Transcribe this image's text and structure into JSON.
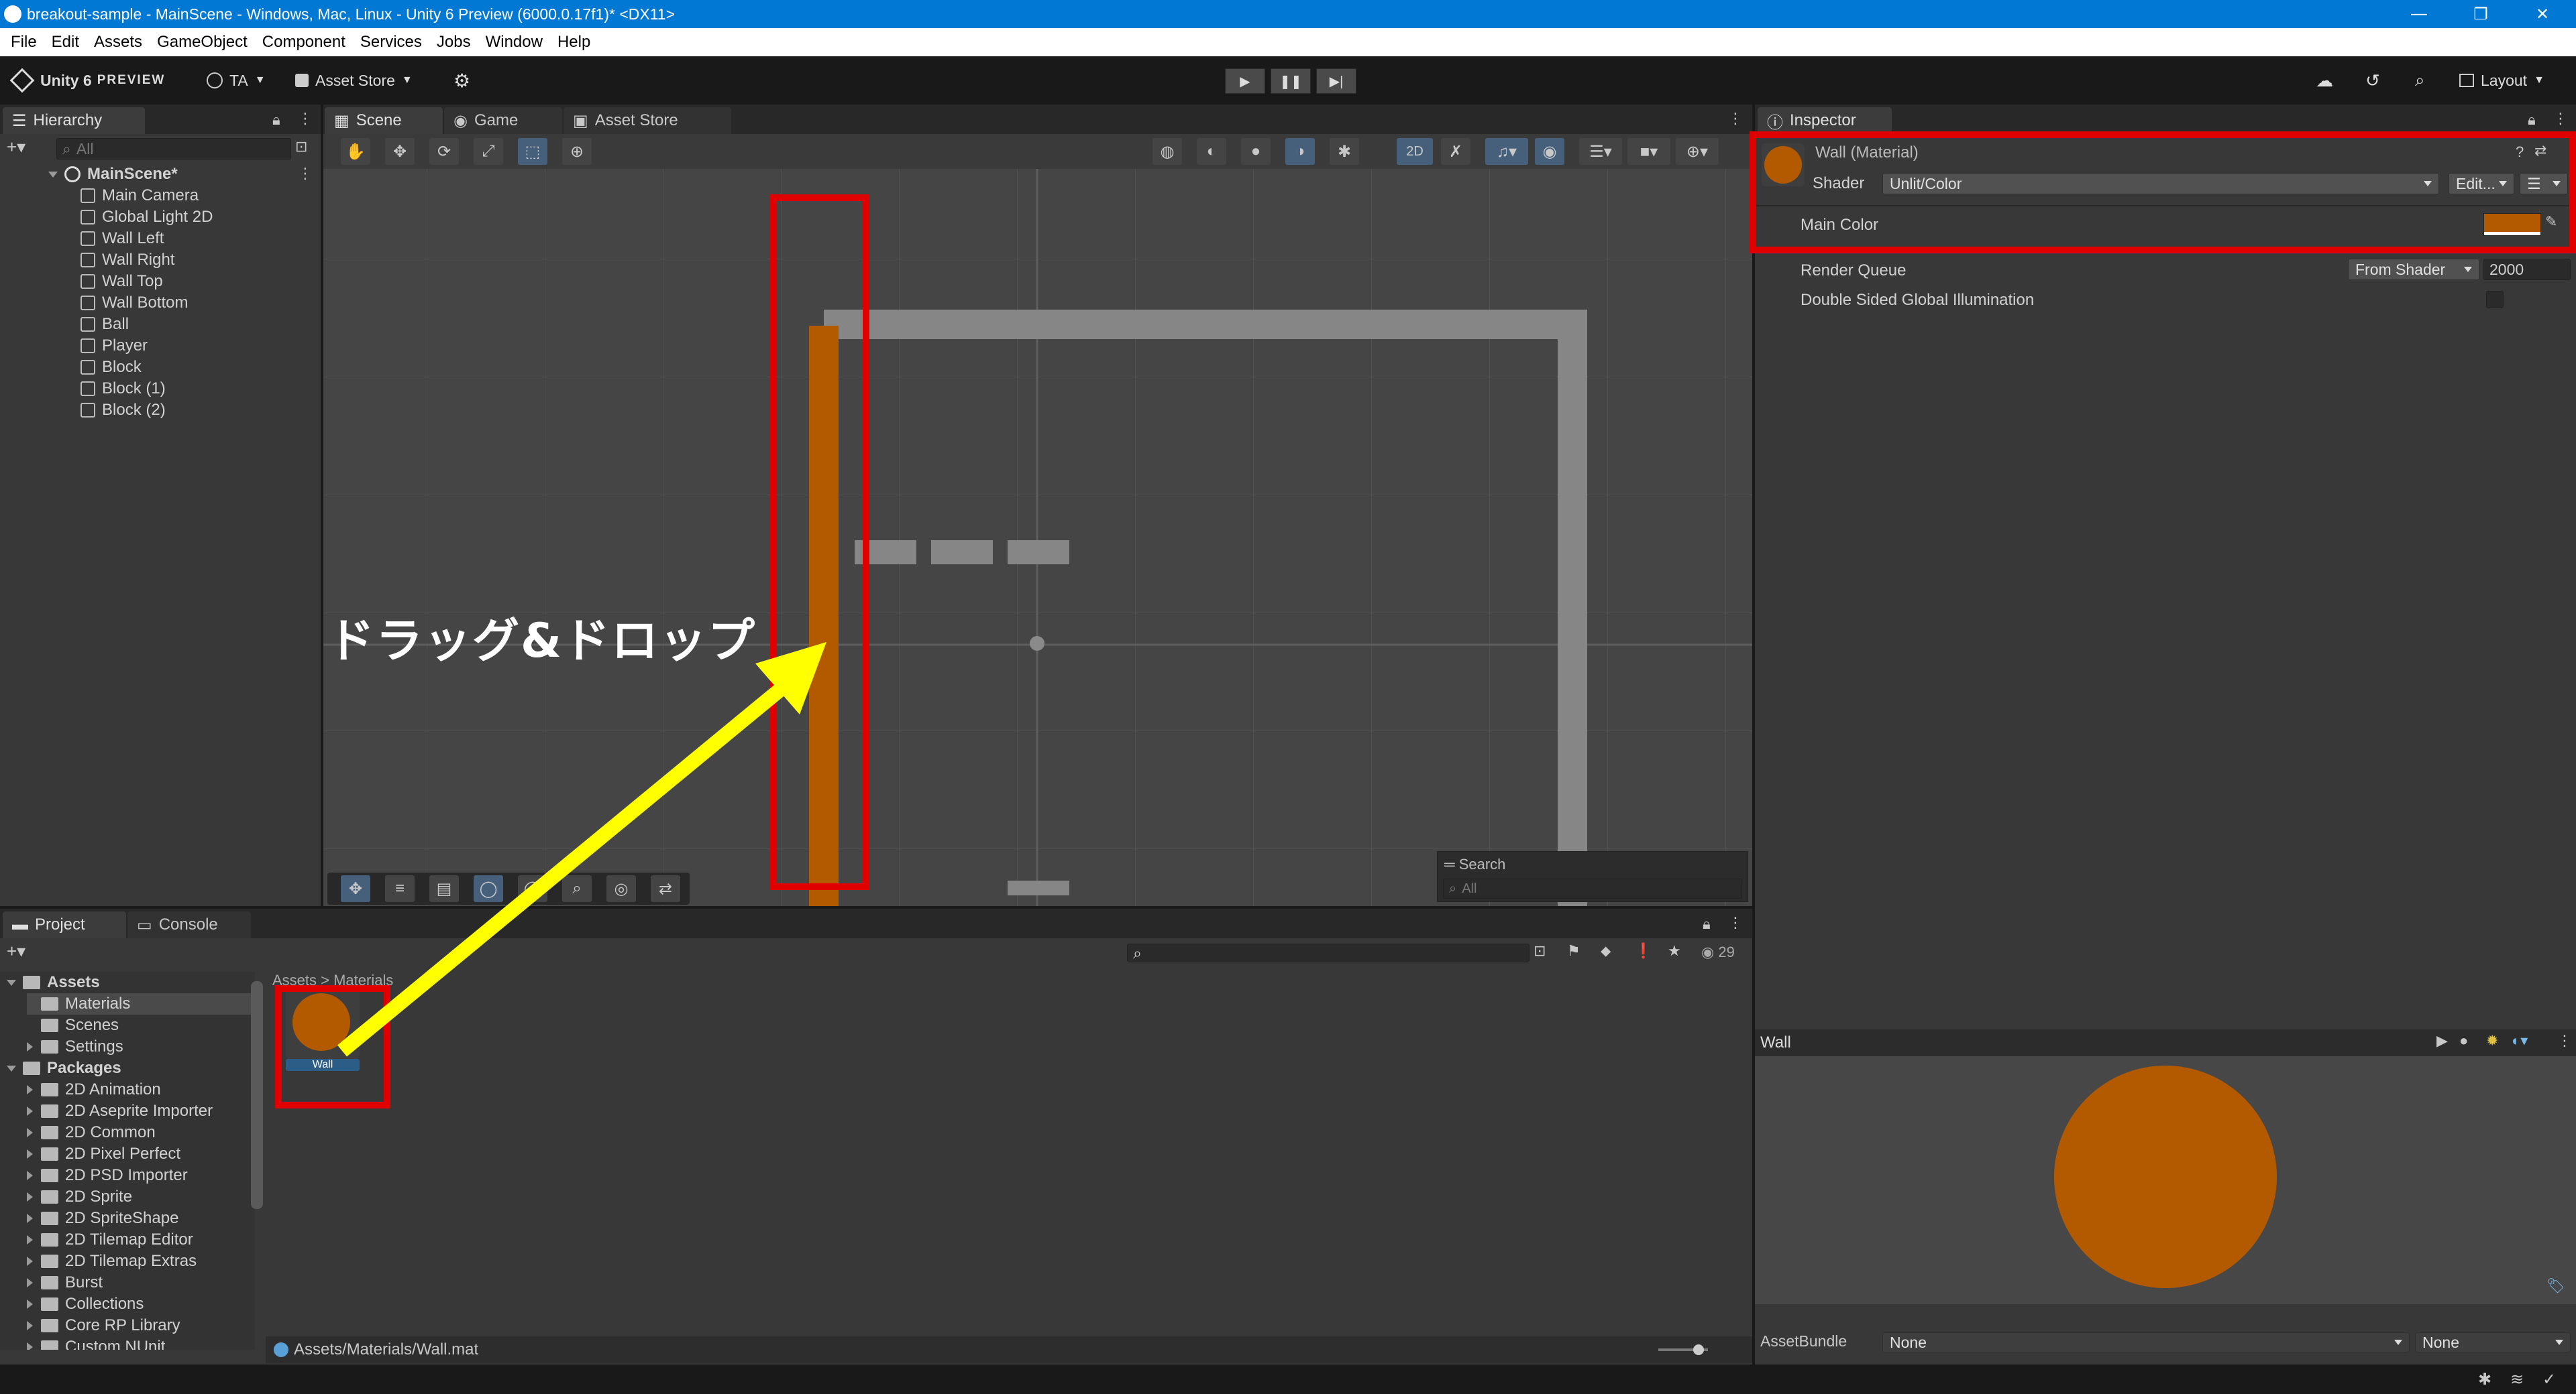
{
  "window": {
    "title": "breakout-sample - MainScene - Windows, Mac, Linux - Unity 6 Preview (6000.0.17f1)* <DX11>"
  },
  "menu": [
    "File",
    "Edit",
    "Assets",
    "GameObject",
    "Component",
    "Services",
    "Jobs",
    "Window",
    "Help"
  ],
  "toolbar": {
    "brand": "Unity 6",
    "brand_suffix": "PREVIEW",
    "account": "TA",
    "asset_store": "Asset Store",
    "layout": "Layout"
  },
  "hierarchy": {
    "tab": "Hierarchy",
    "search_placeholder": "All",
    "scene": "MainScene*",
    "items": [
      "Main Camera",
      "Global Light 2D",
      "Wall Left",
      "Wall Right",
      "Wall Top",
      "Wall Bottom",
      "Ball",
      "Player",
      "Block",
      "Block (1)",
      "Block (2)"
    ]
  },
  "center_tabs": [
    "Scene",
    "Game",
    "Asset Store"
  ],
  "scene": {
    "toggle_2d": "2D",
    "search_label": "Search",
    "search_placeholder": "All",
    "annotation": "ドラッグ&ドロップ"
  },
  "project": {
    "tabs": [
      "Project",
      "Console"
    ],
    "breadcrumb": "Assets > Materials",
    "count": "29",
    "tree": [
      {
        "label": "Assets",
        "level": 0,
        "expanded": true,
        "bold": true
      },
      {
        "label": "Materials",
        "level": 1,
        "selected": true
      },
      {
        "label": "Scenes",
        "level": 1
      },
      {
        "label": "Settings",
        "level": 1,
        "collapsible": true
      },
      {
        "label": "Packages",
        "level": 0,
        "expanded": true,
        "bold": true
      },
      {
        "label": "2D Animation",
        "level": 1,
        "collapsible": true
      },
      {
        "label": "2D Aseprite Importer",
        "level": 1,
        "collapsible": true
      },
      {
        "label": "2D Common",
        "level": 1,
        "collapsible": true
      },
      {
        "label": "2D Pixel Perfect",
        "level": 1,
        "collapsible": true
      },
      {
        "label": "2D PSD Importer",
        "level": 1,
        "collapsible": true
      },
      {
        "label": "2D Sprite",
        "level": 1,
        "collapsible": true
      },
      {
        "label": "2D SpriteShape",
        "level": 1,
        "collapsible": true
      },
      {
        "label": "2D Tilemap Editor",
        "level": 1,
        "collapsible": true
      },
      {
        "label": "2D Tilemap Extras",
        "level": 1,
        "collapsible": true
      },
      {
        "label": "Burst",
        "level": 1,
        "collapsible": true
      },
      {
        "label": "Collections",
        "level": 1,
        "collapsible": true
      },
      {
        "label": "Core RP Library",
        "level": 1,
        "collapsible": true
      },
      {
        "label": "Custom NUnit",
        "level": 1,
        "collapsible": true
      }
    ],
    "asset_name": "Wall",
    "path": "Assets/Materials/Wall.mat"
  },
  "inspector": {
    "tab": "Inspector",
    "material_name": "Wall (Material)",
    "shader_label": "Shader",
    "shader_value": "Unlit/Color",
    "edit_label": "Edit...",
    "main_color_label": "Main Color",
    "render_queue_label": "Render Queue",
    "render_queue_mode": "From Shader",
    "render_queue_value": "2000",
    "double_sided_label": "Double Sided Global Illumination",
    "preview_title": "Wall",
    "assetbundle_label": "AssetBundle",
    "assetbundle_value": "None",
    "assetbundle_variant": "None"
  },
  "colors": {
    "material": "#b35a00",
    "highlight": "#e00000",
    "arrow": "#ffff00",
    "titlebar": "#0078d4"
  }
}
